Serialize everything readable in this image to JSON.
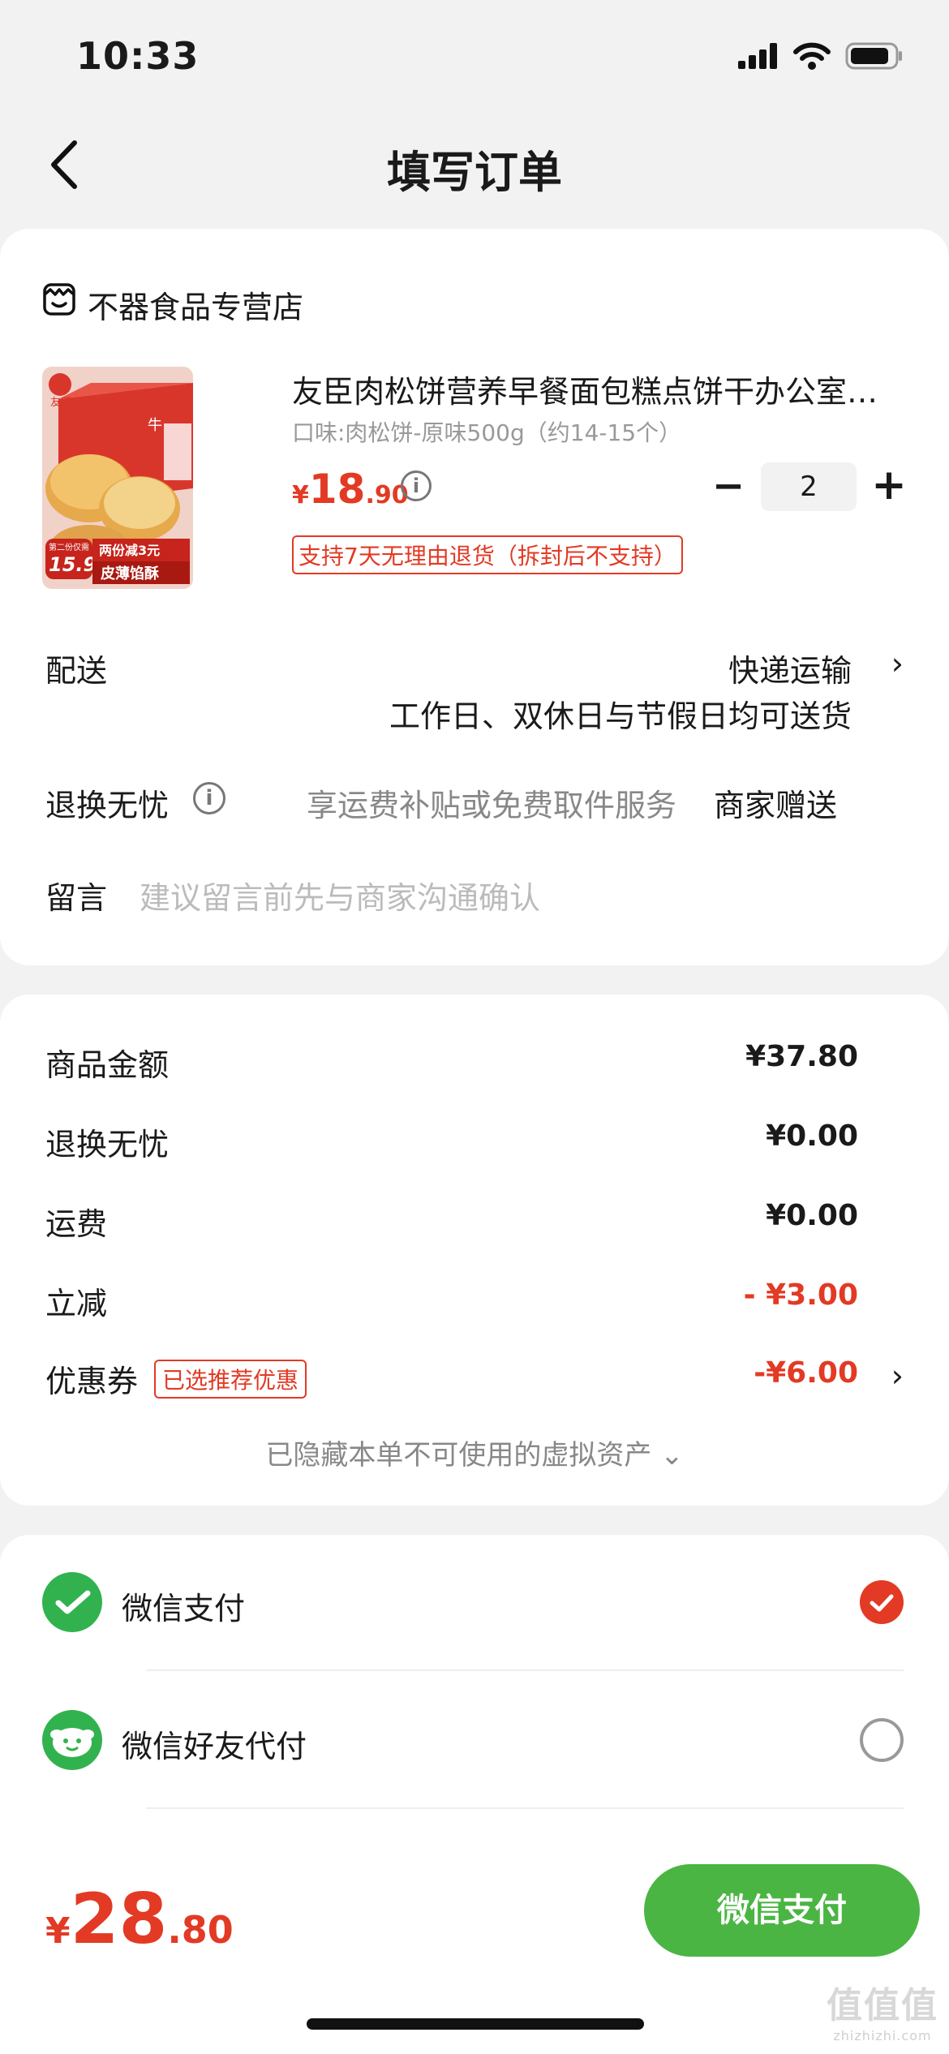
{
  "status_bar": {
    "time": "10:33"
  },
  "nav": {
    "title": "填写订单"
  },
  "store": {
    "name": "不器食品专营店",
    "product": {
      "title": "友臣肉松饼营养早餐面包糕点饼干办公室…",
      "spec": "口味:肉松饼-原味500g（约14-15个）",
      "price_symbol": "¥",
      "price_int": "18",
      "price_dec": ".90",
      "quantity": "2",
      "return_policy": "支持7天无理由退货（拆封后不支持）",
      "image_texts": {
        "brand": "友臣",
        "promo": "两份减3元",
        "price_tag": "15.9",
        "second_item": "第二份仅需",
        "tagline": "皮薄馅酥"
      }
    },
    "delivery": {
      "label": "配送",
      "method": "快递运输",
      "note": "工作日、双休日与节假日均可送货"
    },
    "return_guarantee": {
      "label": "退换无忧",
      "desc": "享运费补贴或免费取件服务",
      "gift": "商家赠送"
    },
    "note": {
      "label": "留言",
      "placeholder": "建议留言前先与商家沟通确认"
    }
  },
  "totals": {
    "goods_label": "商品金额",
    "goods_value": "¥37.80",
    "return_label": "退换无忧",
    "return_value": "¥0.00",
    "shipping_label": "运费",
    "shipping_value": "¥0.00",
    "discount_label": "立减",
    "discount_value": "- ¥3.00",
    "coupon_label": "优惠券",
    "coupon_badge": "已选推荐优惠",
    "coupon_value": "-¥6.00",
    "hidden_assets": "已隐藏本单不可使用的虚拟资产 ⌄"
  },
  "payment": {
    "option1": "微信支付",
    "option2": "微信好友代付"
  },
  "bottom": {
    "symbol": "¥",
    "int": "28",
    "dec": ".80",
    "pay_button": "微信支付"
  },
  "watermark": {
    "logo": "值值值",
    "url": "zhizhizhi.com"
  },
  "colors": {
    "accent_red": "#e23a24",
    "wechat_green": "#4ab543"
  }
}
